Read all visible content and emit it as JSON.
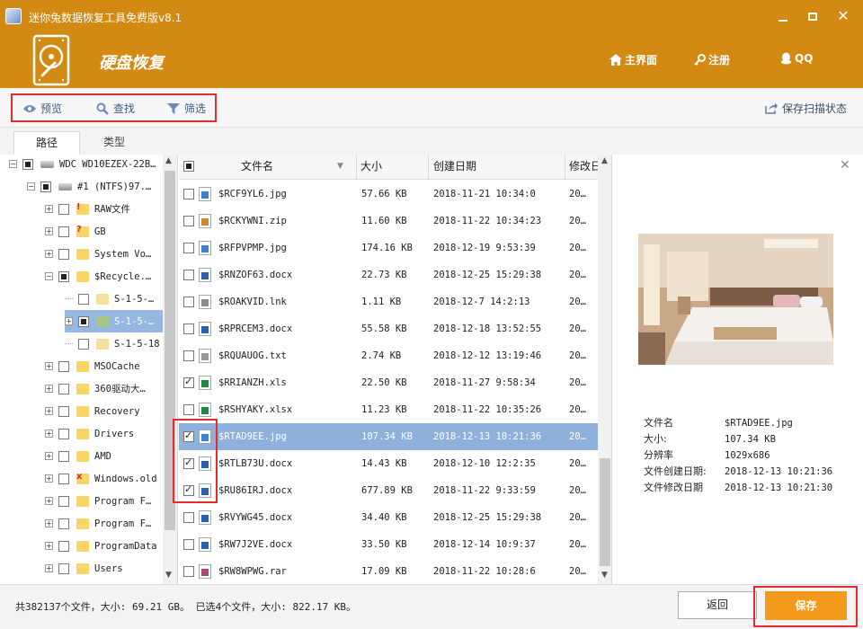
{
  "window": {
    "title": "迷你兔数据恢复工具免费版v8.1",
    "accent": "#d38a12"
  },
  "header": {
    "section_title": "硬盘恢复",
    "nav": [
      {
        "label": "主界面",
        "icon": "home-icon"
      },
      {
        "label": "注册",
        "icon": "key-icon"
      },
      {
        "label": "QQ",
        "icon": "qq-icon"
      }
    ]
  },
  "toolbar": {
    "preview_label": "预览",
    "find_label": "查找",
    "filter_label": "筛选",
    "save_scan_label": "保存扫描状态"
  },
  "tabs": [
    {
      "label": "路径",
      "active": true
    },
    {
      "label": "类型",
      "active": false
    }
  ],
  "tree": {
    "items": [
      {
        "label": "WDC WD10EZEX-22B…",
        "icon": "disk-icon",
        "check": "partial",
        "expand": "-",
        "level": 0
      },
      {
        "label": "#1 (NTFS)97.…",
        "icon": "drive-icon",
        "check": "partial",
        "expand": "-",
        "level": 1
      },
      {
        "label": "RAW文件",
        "icon": "raw-folder-icon",
        "check": "none",
        "expand": "+",
        "level": 2
      },
      {
        "label": "GB",
        "icon": "unknown-folder-icon",
        "check": "none",
        "expand": "+",
        "level": 2
      },
      {
        "label": "System Vo…",
        "icon": "folder-icon",
        "check": "none",
        "expand": "+",
        "level": 2
      },
      {
        "label": "$Recycle.…",
        "icon": "folder-icon",
        "check": "partial",
        "expand": "-",
        "level": 2
      },
      {
        "label": "S-1-5-…",
        "icon": "folder-icon",
        "check": "none",
        "expand": "",
        "level": 3
      },
      {
        "label": "S-1-5-…",
        "icon": "folder-icon",
        "check": "partial",
        "expand": "+",
        "level": 3,
        "selected": true
      },
      {
        "label": "S-1-5-18",
        "icon": "folder-icon",
        "check": "none",
        "expand": "",
        "level": 3
      },
      {
        "label": "MSOCache",
        "icon": "folder-icon",
        "check": "none",
        "expand": "+",
        "level": 2
      },
      {
        "label": "360驱动大…",
        "icon": "folder-icon",
        "check": "none",
        "expand": "+",
        "level": 2
      },
      {
        "label": "Recovery",
        "icon": "folder-icon",
        "check": "none",
        "expand": "+",
        "level": 2
      },
      {
        "label": "Drivers",
        "icon": "folder-icon",
        "check": "none",
        "expand": "+",
        "level": 2
      },
      {
        "label": "AMD",
        "icon": "folder-icon",
        "check": "none",
        "expand": "+",
        "level": 2
      },
      {
        "label": "Windows.old",
        "icon": "deleted-folder-icon",
        "check": "none",
        "expand": "+",
        "level": 2
      },
      {
        "label": "Program F…",
        "icon": "folder-icon",
        "check": "none",
        "expand": "+",
        "level": 2
      },
      {
        "label": "Program F…",
        "icon": "folder-icon",
        "check": "none",
        "expand": "+",
        "level": 2
      },
      {
        "label": "ProgramData",
        "icon": "folder-icon",
        "check": "none",
        "expand": "+",
        "level": 2
      },
      {
        "label": "Users",
        "icon": "folder-icon",
        "check": "none",
        "expand": "+",
        "level": 2
      }
    ]
  },
  "filelist": {
    "columns": [
      "文件名",
      "大小",
      "创建日期",
      "修改日"
    ],
    "rows": [
      {
        "name": "$RCF9YL6.jpg",
        "size": "57.66 KB",
        "created": "2018-11-21 10:34:0",
        "modified": "20…",
        "type": "jpg",
        "checked": false
      },
      {
        "name": "$RCKYWNI.zip",
        "size": "11.60 KB",
        "created": "2018-11-22 10:34:23",
        "modified": "20…",
        "type": "zip",
        "checked": false
      },
      {
        "name": "$RFPVPMP.jpg",
        "size": "174.16 KB",
        "created": "2018-12-19 9:53:39",
        "modified": "20…",
        "type": "jpg",
        "checked": false
      },
      {
        "name": "$RNZOF63.docx",
        "size": "22.73 KB",
        "created": "2018-12-25 15:29:38",
        "modified": "20…",
        "type": "docx",
        "checked": false
      },
      {
        "name": "$ROAKVID.lnk",
        "size": "1.11 KB",
        "created": "2018-12-7 14:2:13",
        "modified": "20…",
        "type": "lnk",
        "checked": false
      },
      {
        "name": "$RPRCEM3.docx",
        "size": "55.58 KB",
        "created": "2018-12-18 13:52:55",
        "modified": "20…",
        "type": "docx",
        "checked": false
      },
      {
        "name": "$RQUAUOG.txt",
        "size": "2.74 KB",
        "created": "2018-12-12 13:19:46",
        "modified": "20…",
        "type": "txt",
        "checked": false
      },
      {
        "name": "$RRIANZH.xls",
        "size": "22.50 KB",
        "created": "2018-11-27 9:58:34",
        "modified": "20…",
        "type": "xls",
        "checked": true
      },
      {
        "name": "$RSHYAKY.xlsx",
        "size": "11.23 KB",
        "created": "2018-11-22 10:35:26",
        "modified": "20…",
        "type": "xls",
        "checked": false
      },
      {
        "name": "$RTAD9EE.jpg",
        "size": "107.34 KB",
        "created": "2018-12-13 10:21:36",
        "modified": "20…",
        "type": "jpg",
        "checked": true,
        "selected": true
      },
      {
        "name": "$RTLB73U.docx",
        "size": "14.43 KB",
        "created": "2018-12-10 12:2:35",
        "modified": "20…",
        "type": "docx",
        "checked": true
      },
      {
        "name": "$RU86IRJ.docx",
        "size": "677.89 KB",
        "created": "2018-11-22 9:33:59",
        "modified": "20…",
        "type": "docx",
        "checked": true
      },
      {
        "name": "$RVYWG45.docx",
        "size": "34.40 KB",
        "created": "2018-12-25 15:29:38",
        "modified": "20…",
        "type": "docx",
        "checked": false
      },
      {
        "name": "$RW7J2VE.docx",
        "size": "33.50 KB",
        "created": "2018-12-14 10:9:37",
        "modified": "20…",
        "type": "docx",
        "checked": false
      },
      {
        "name": "$RW8WPWG.rar",
        "size": "17.09 KB",
        "created": "2018-11-22 10:28:6",
        "modified": "20…",
        "type": "rar",
        "checked": false
      }
    ]
  },
  "preview": {
    "meta": [
      {
        "key": "文件名",
        "value": "$RTAD9EE.jpg"
      },
      {
        "key": "大小:",
        "value": "107.34 KB"
      },
      {
        "key": "分辨率",
        "value": "1029x686"
      },
      {
        "key": "文件创建日期:",
        "value": "2018-12-13 10:21:36"
      },
      {
        "key": "文件修改日期",
        "value": "2018-12-13 10:21:30"
      }
    ]
  },
  "status": {
    "text": "共382137个文件，大小: 69.21 GB。 已选4个文件，大小: 822.17 KB。",
    "back_label": "返回",
    "save_label": "保存",
    "save_color": "#f39a1c"
  }
}
